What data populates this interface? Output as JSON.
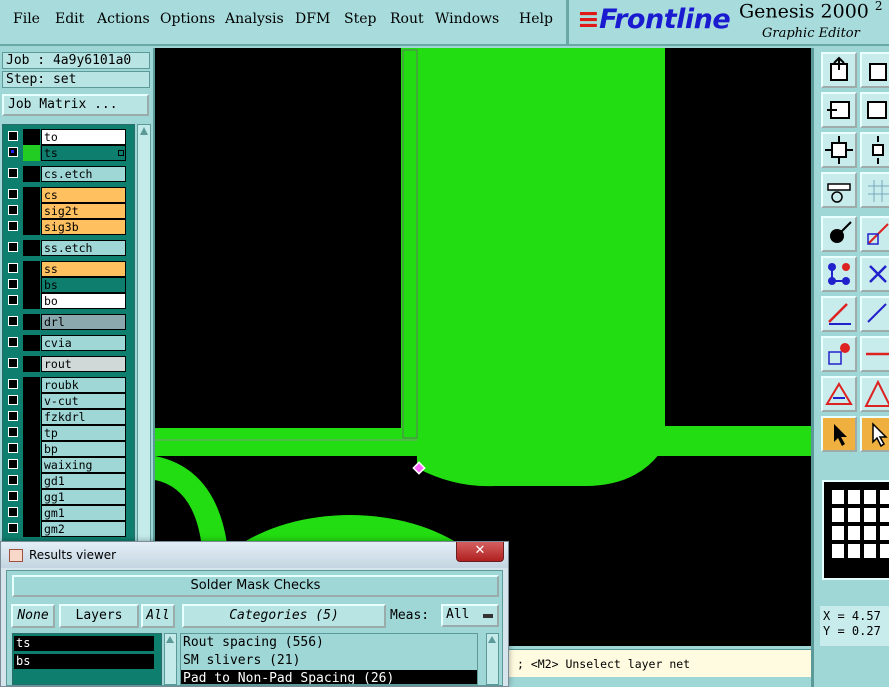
{
  "menu": [
    "File",
    "Edit",
    "Actions",
    "Options",
    "Analysis",
    "DFM",
    "Step",
    "Rout",
    "Windows",
    "Help"
  ],
  "brand": {
    "logo": "Frontline",
    "title": "Genesis 2000",
    "title_sup": "2",
    "subtitle": "Graphic Editor"
  },
  "job": {
    "job_label": "Job : 4a9y6101a0",
    "step_label": "Step: set",
    "matrix_button": "Job Matrix ..."
  },
  "layers": [
    {
      "name": "to",
      "color": "#ffffff",
      "swatch": "#000000",
      "checked": false
    },
    {
      "name": "ts",
      "color": "#0e7f6e",
      "swatch": "#22cc22",
      "checked": true
    },
    {
      "name": "cs.etch",
      "color": "#9fd6d6",
      "swatch": "#000000",
      "checked": false
    },
    {
      "name": "cs",
      "color": "#ffc060",
      "swatch": "#000000",
      "checked": false
    },
    {
      "name": "sig2t",
      "color": "#ffc060",
      "swatch": "#000000",
      "checked": false
    },
    {
      "name": "sig3b",
      "color": "#ffc060",
      "swatch": "#000000",
      "checked": false
    },
    {
      "name": "ss.etch",
      "color": "#9fd6d6",
      "swatch": "#000000",
      "checked": false
    },
    {
      "name": "ss",
      "color": "#ffc060",
      "swatch": "#000000",
      "checked": false
    },
    {
      "name": "bs",
      "color": "#0e7f6e",
      "swatch": "#000000",
      "checked": false
    },
    {
      "name": "bo",
      "color": "#ffffff",
      "swatch": "#000000",
      "checked": false
    },
    {
      "name": "drl",
      "color": "#8aa8ae",
      "swatch": "#000000",
      "checked": false
    },
    {
      "name": "cvia",
      "color": "#9fd6d6",
      "swatch": "#000000",
      "checked": false
    },
    {
      "name": "rout",
      "color": "#d0d8d8",
      "swatch": "#000000",
      "checked": false
    },
    {
      "name": "roubk",
      "color": "#9fd6d6",
      "swatch": "#000000",
      "checked": false
    },
    {
      "name": "v-cut",
      "color": "#9fd6d6",
      "swatch": "#000000",
      "checked": false
    },
    {
      "name": "fzkdrl",
      "color": "#9fd6d6",
      "swatch": "#000000",
      "checked": false
    },
    {
      "name": "tp",
      "color": "#9fd6d6",
      "swatch": "#000000",
      "checked": false
    },
    {
      "name": "bp",
      "color": "#9fd6d6",
      "swatch": "#000000",
      "checked": false
    },
    {
      "name": "waixing",
      "color": "#9fd6d6",
      "swatch": "#000000",
      "checked": false
    },
    {
      "name": "gd1",
      "color": "#9fd6d6",
      "swatch": "#000000",
      "checked": false
    },
    {
      "name": "gg1",
      "color": "#9fd6d6",
      "swatch": "#000000",
      "checked": false
    },
    {
      "name": "gm1",
      "color": "#9fd6d6",
      "swatch": "#000000",
      "checked": false
    },
    {
      "name": "gm2",
      "color": "#9fd6d6",
      "swatch": "#000000",
      "checked": false
    }
  ],
  "colors": {
    "copper": "#22dd11",
    "canvas": "#000000",
    "panel": "#9fd6d6"
  },
  "right_tools": [
    "import-icon",
    "nudge-left-icon",
    "zoom-fit-icon",
    "measure-icon",
    "pad-select-icon",
    "net-icon",
    "line-icon",
    "feature-icon",
    "triangle-icon",
    "pointer-icon"
  ],
  "coords": {
    "x": "X = 4.57",
    "y": "Y = 0.27"
  },
  "status": "; <M2> Unselect layer net",
  "results_viewer": {
    "title": "Results viewer",
    "close": "✕",
    "header": "Solder Mask Checks",
    "btn_none": "None",
    "btn_layers": "Layers",
    "btn_all": "All",
    "btn_categories": "Categories (5)",
    "meas_label": "Meas:",
    "meas_value": "All",
    "layers": [
      "ts",
      "bs"
    ],
    "categories": [
      {
        "label": "Rout spacing (556)",
        "selected": false
      },
      {
        "label": "SM slivers (21)",
        "selected": false
      },
      {
        "label": "Pad to Non-Pad Spacing (26)",
        "selected": true
      }
    ]
  }
}
